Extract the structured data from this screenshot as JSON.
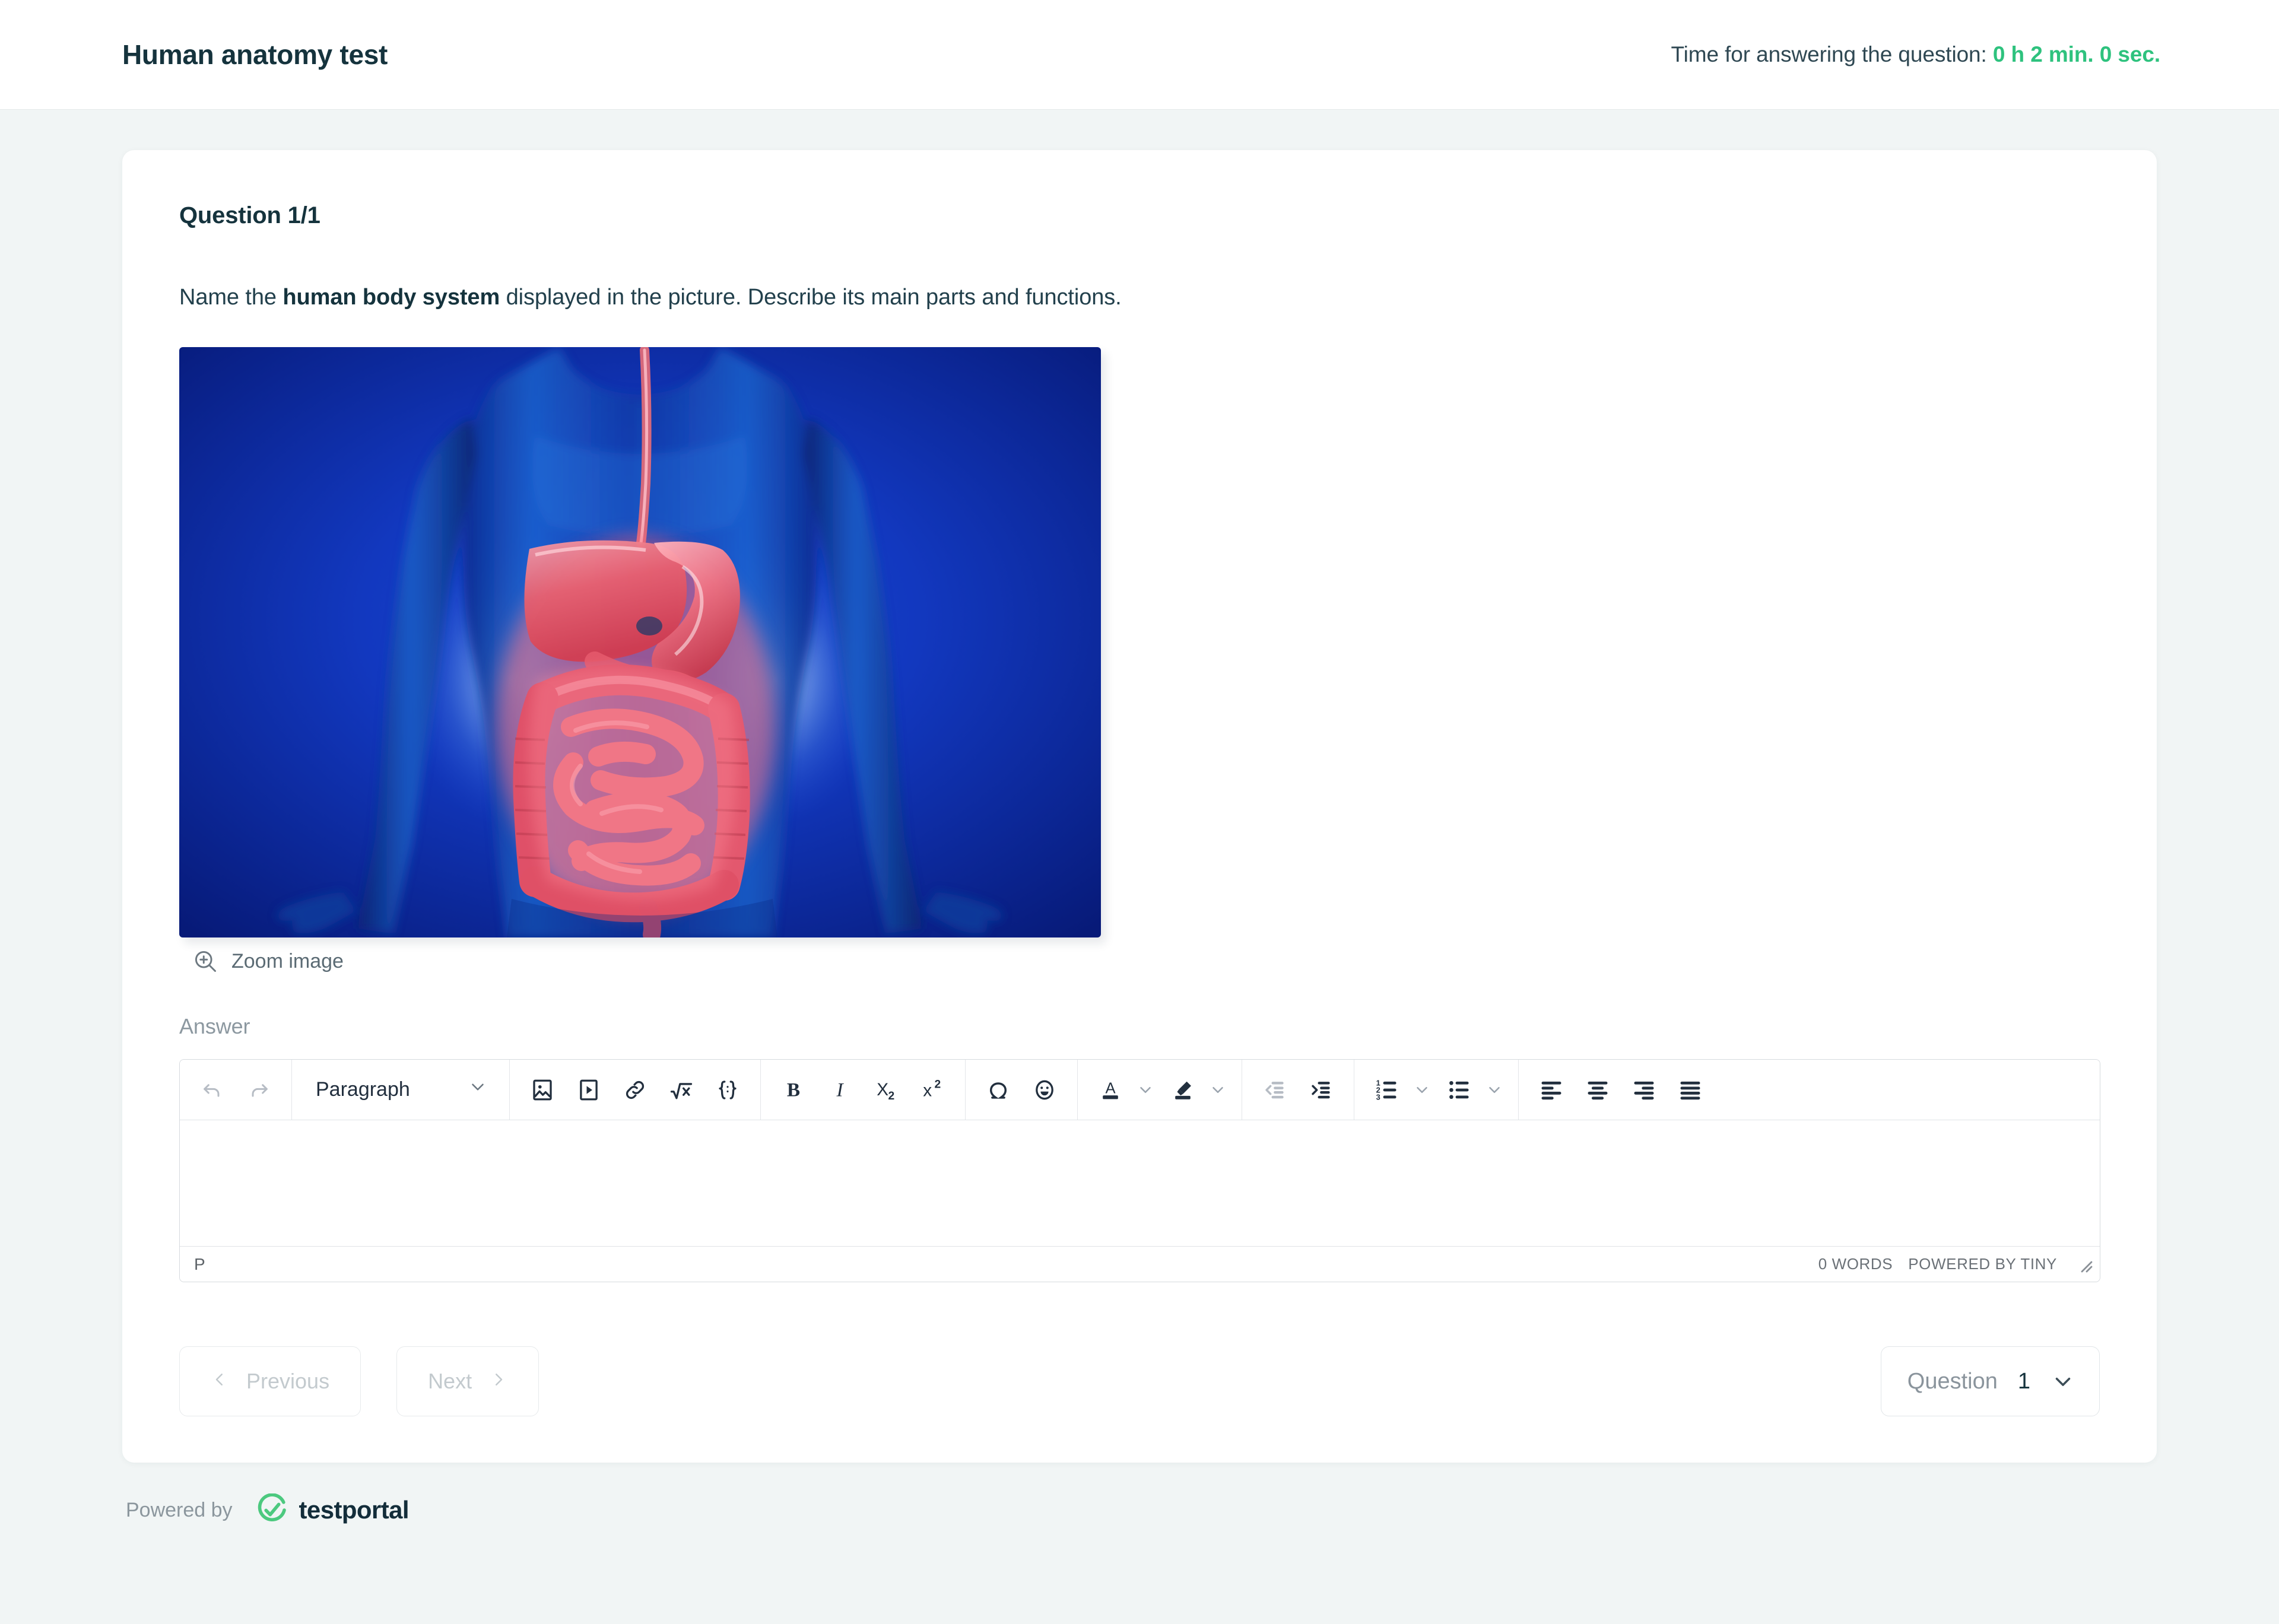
{
  "header": {
    "title": "Human anatomy test",
    "timer_label": "Time for answering the question:",
    "timer_value": "0 h 2 min. 0 sec.",
    "timer_color": "#2ec27e"
  },
  "question": {
    "counter": "Question 1/1",
    "prompt_part1": "Name the ",
    "prompt_bold": "human body system",
    "prompt_part2": " displayed in the picture. Describe its main parts and functions.",
    "image_alt": "Human torso showing the digestive system highlighted in red over a blue anatomical body",
    "zoom_link": "Zoom image",
    "zoom_icon": "magnifier-plus-icon"
  },
  "answer": {
    "label": "Answer",
    "editor_content": "",
    "status_path": "P",
    "word_count": "0 WORDS",
    "branding": "POWERED BY TINY",
    "resize_icon": "resize-grip-icon"
  },
  "toolbar": {
    "undo": {
      "label": "Undo",
      "icon": "undo-icon",
      "disabled": true
    },
    "redo": {
      "label": "Redo",
      "icon": "redo-icon",
      "disabled": true
    },
    "block_format": {
      "value": "Paragraph",
      "icon": "chevron-down-icon"
    },
    "insert_image": {
      "label": "Insert image",
      "icon": "image-icon"
    },
    "insert_media": {
      "label": "Insert media",
      "icon": "media-play-icon"
    },
    "insert_link": {
      "label": "Insert link",
      "icon": "link-icon"
    },
    "insert_math": {
      "label": "Insert math",
      "icon": "square-root-icon"
    },
    "source_code": {
      "label": "Source code",
      "icon": "code-braces-icon"
    },
    "bold": {
      "label": "B",
      "icon": "bold-icon"
    },
    "italic": {
      "label": "I",
      "icon": "italic-icon"
    },
    "subscript": {
      "label": "X2",
      "icon": "subscript-icon"
    },
    "superscript": {
      "label": "X2",
      "icon": "superscript-icon"
    },
    "special_char": {
      "label": "Special character",
      "icon": "omega-icon"
    },
    "emoticon": {
      "label": "Emoticons",
      "icon": "smiley-icon"
    },
    "text_color": {
      "label": "Text color",
      "icon": "text-color-icon"
    },
    "background_color": {
      "label": "Background color",
      "icon": "highlight-color-icon"
    },
    "outdent": {
      "label": "Decrease indent",
      "icon": "outdent-icon",
      "disabled": true
    },
    "indent": {
      "label": "Increase indent",
      "icon": "indent-icon"
    },
    "numbered_list": {
      "label": "Numbered list",
      "icon": "ordered-list-icon"
    },
    "bullet_list": {
      "label": "Bullet list",
      "icon": "unordered-list-icon"
    },
    "align_left": {
      "label": "Align left",
      "icon": "align-left-icon"
    },
    "align_center": {
      "label": "Align center",
      "icon": "align-center-icon"
    },
    "align_right": {
      "label": "Align right",
      "icon": "align-right-icon"
    },
    "justify": {
      "label": "Justify",
      "icon": "align-justify-icon"
    }
  },
  "navigation": {
    "previous": "Previous",
    "next": "Next",
    "prev_icon": "chevron-left-icon",
    "next_icon": "chevron-right-icon",
    "question_select_label": "Question",
    "question_select_value": "1",
    "question_select_icon": "chevron-down-icon"
  },
  "footer": {
    "powered_by": "Powered by",
    "brand": "testportal",
    "brand_icon": "testportal-check-logo",
    "brand_color": "#4cc97f"
  }
}
